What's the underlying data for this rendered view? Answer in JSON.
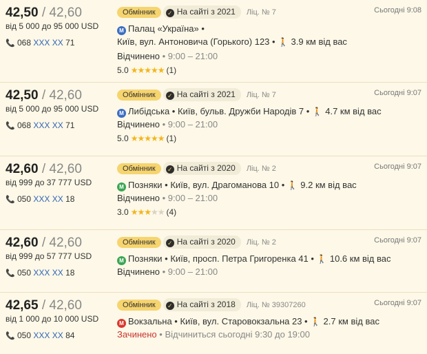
{
  "offers": [
    {
      "buy": "42,50",
      "sell": "42,60",
      "range": "від 5 000 до 95 000 USD",
      "phone_prefix": "068",
      "phone_hidden": "XXX XX",
      "phone_suffix": "71",
      "type": "Обмінник",
      "on_site": "На сайті з 2021",
      "license": "Ліц. № 7",
      "time": "Сьогодні 9:08",
      "metro_color": "#3b6ec4",
      "address_line1": "Палац «Україна» •",
      "address_line2": "Київ, вул. Антоновича (Горького) 123 •",
      "distance": "3.9  км від вас",
      "status": "Відчинено",
      "hours": "• 9:00 – 21:00",
      "rating": "5.0",
      "stars": 5,
      "reviews": "(1)"
    },
    {
      "buy": "42,50",
      "sell": "42,60",
      "range": "від 5 000 до 95 000 USD",
      "phone_prefix": "068",
      "phone_hidden": "XXX XX",
      "phone_suffix": "71",
      "type": "Обмінник",
      "on_site": "На сайті з 2021",
      "license": "Ліц. № 7",
      "time": "Сьогодні 9:07",
      "metro_color": "#3b6ec4",
      "address_line1": "Либідська • Київ, бульв. Дружби Народів 7 •",
      "distance": "4.7  км від вас",
      "status": "Відчинено",
      "hours": "• 9:00 – 21:00",
      "rating": "5.0",
      "stars": 5,
      "reviews": "(1)"
    },
    {
      "buy": "42,60",
      "sell": "42,60",
      "range": "від 999 до 37 777 USD",
      "phone_prefix": "050",
      "phone_hidden": "XXX XX",
      "phone_suffix": "18",
      "type": "Обмінник",
      "on_site": "На сайті з 2020",
      "license": "Ліц. № 2",
      "time": "Сьогодні 9:07",
      "metro_color": "#3aa655",
      "address_line1": "Позняки • Київ, вул. Драгоманова 10 •",
      "distance": "9.2  км від вас",
      "status": "Відчинено",
      "hours": "• 9:00 – 21:00",
      "rating": "3.0",
      "stars": 3,
      "reviews": "(4)"
    },
    {
      "buy": "42,60",
      "sell": "42,60",
      "range": "від 999 до 57 777 USD",
      "phone_prefix": "050",
      "phone_hidden": "XXX XX",
      "phone_suffix": "18",
      "type": "Обмінник",
      "on_site": "На сайті з 2020",
      "license": "Ліц. № 2",
      "time": "Сьогодні 9:07",
      "metro_color": "#3aa655",
      "address_line1": "Позняки • Київ, просп. Петра Григоренка 41 •",
      "distance": "10.6  км від вас",
      "status": "Відчинено",
      "hours": "• 9:00 – 21:00"
    },
    {
      "buy": "42,65",
      "sell": "42,60",
      "range": "від 1 000 до 10 000 USD",
      "phone_prefix": "050",
      "phone_hidden": "XXX XX",
      "phone_suffix": "84",
      "type": "Обмінник",
      "on_site": "На сайті з 2018",
      "license": "Ліц. № 39307260",
      "time": "Сьогодні 9:07",
      "metro_color": "#d9382e",
      "address_line1": "Вокзальна • Київ, вул. Старовокзальна 23 •",
      "distance": "2.7  км від вас",
      "status": "Зачинено",
      "status_closed": true,
      "hours": "• Відчиниться сьогодні 9:30 до 19:00"
    }
  ]
}
